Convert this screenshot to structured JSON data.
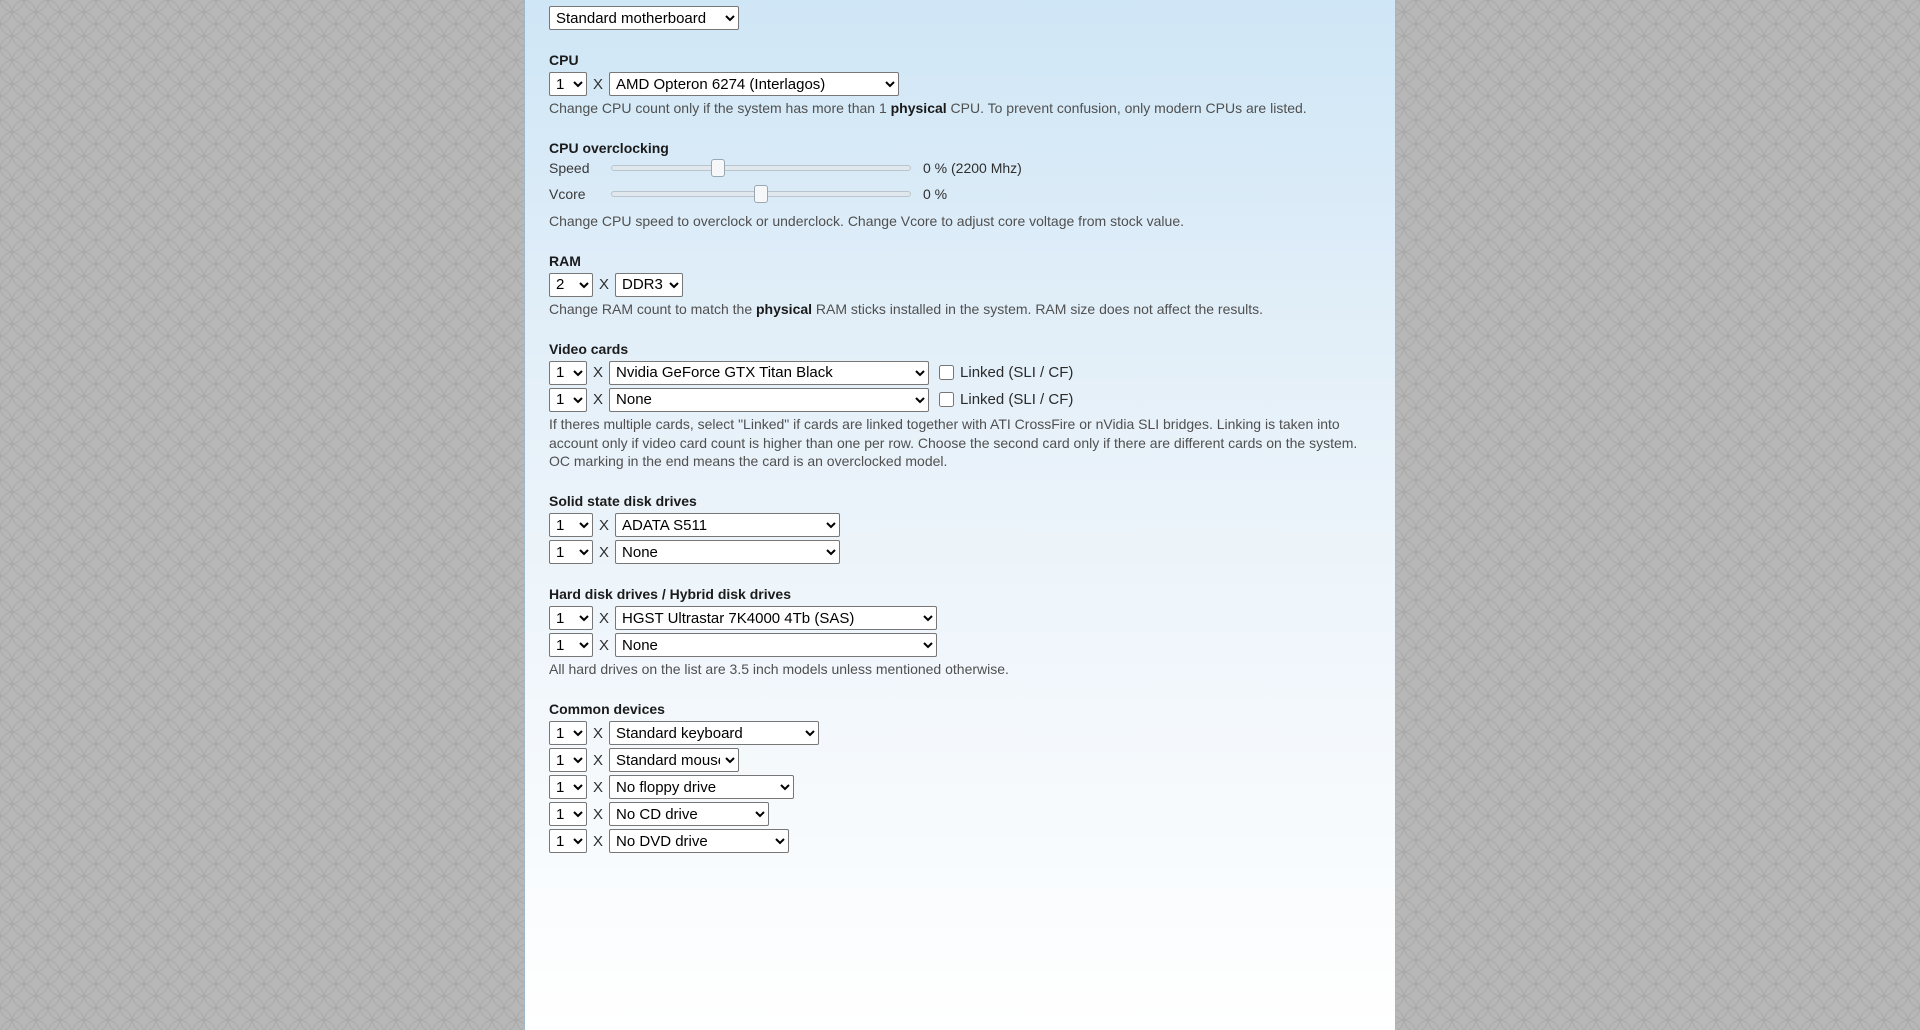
{
  "motherboard": {
    "value": "Standard motherboard"
  },
  "cpu": {
    "title": "CPU",
    "count": "1",
    "x": "X",
    "model": "AMD Opteron 6274 (Interlagos)",
    "help_before": "Change CPU count only if the system has more than 1 ",
    "help_bold": "physical",
    "help_after": " CPU. To prevent confusion, only modern CPUs are listed."
  },
  "overclock": {
    "title": "CPU overclocking",
    "speed_label": "Speed",
    "speed_value": "0 % (2200 Mhz)",
    "vcore_label": "Vcore",
    "vcore_value": "0 %",
    "help": "Change CPU speed to overclock or underclock. Change Vcore to adjust core voltage from stock value."
  },
  "ram": {
    "title": "RAM",
    "count": "2",
    "type": "DDR3",
    "help_before": "Change RAM count to match the ",
    "help_bold": "physical",
    "help_after": " RAM sticks installed in the system. RAM size does not affect the results."
  },
  "video": {
    "title": "Video cards",
    "row1": {
      "count": "1",
      "model": "Nvidia GeForce GTX Titan Black",
      "linked_label": "Linked (SLI / CF)"
    },
    "row2": {
      "count": "1",
      "model": "None",
      "linked_label": "Linked (SLI / CF)"
    },
    "help": "If theres multiple cards, select \"Linked\" if cards are linked together with ATI CrossFire or nVidia SLI bridges. Linking is taken into account only if video card count is higher than one per row. Choose the second card only if there are different cards on the system. OC marking in the end means the card is an overclocked model."
  },
  "ssd": {
    "title": "Solid state disk drives",
    "row1": {
      "count": "1",
      "model": "ADATA S511"
    },
    "row2": {
      "count": "1",
      "model": "None"
    }
  },
  "hdd": {
    "title": "Hard disk drives / Hybrid disk drives",
    "row1": {
      "count": "1",
      "model": "HGST Ultrastar 7K4000 4Tb (SAS)"
    },
    "row2": {
      "count": "1",
      "model": "None"
    },
    "help": "All hard drives on the list are 3.5 inch models unless mentioned otherwise."
  },
  "common": {
    "title": "Common devices",
    "rows": [
      {
        "count": "1",
        "model": "Standard keyboard"
      },
      {
        "count": "1",
        "model": "Standard mouse"
      },
      {
        "count": "1",
        "model": "No floppy drive"
      },
      {
        "count": "1",
        "model": "No CD drive"
      },
      {
        "count": "1",
        "model": "No DVD drive"
      }
    ]
  },
  "x": "X"
}
